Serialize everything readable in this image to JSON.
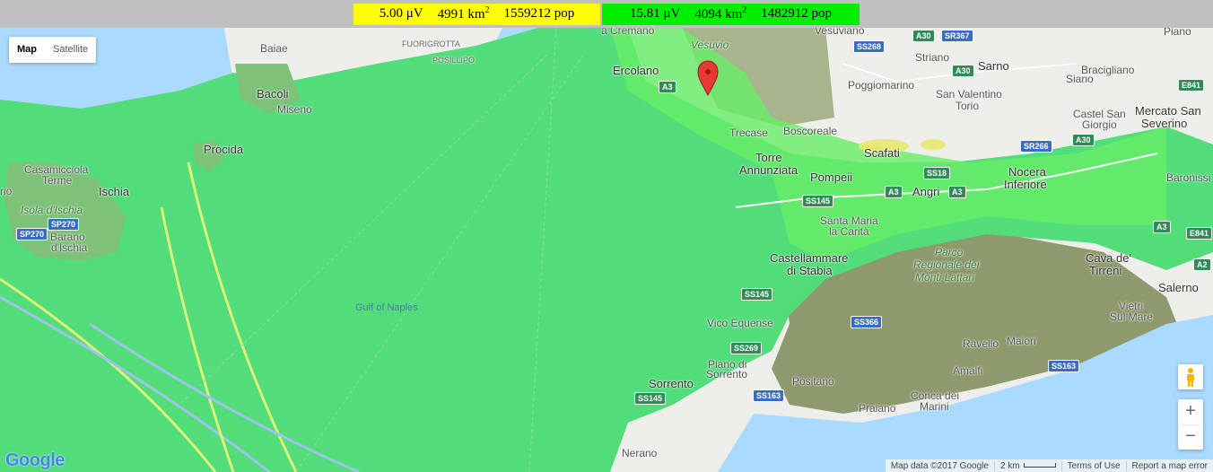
{
  "legend": [
    {
      "level": "5.00 μV",
      "area_base": "4991 km",
      "area_sup": "2",
      "pop": "1559212 pop",
      "color": "#ffff00"
    },
    {
      "level": "15.81 μV",
      "area_base": "4094 km",
      "area_sup": "2",
      "pop": "1482912 pop",
      "color": "#00ee00"
    }
  ],
  "map_type": {
    "map_label": "Map",
    "satellite_label": "Satellite",
    "selected": "Map"
  },
  "places": {
    "baiae": "Baiae",
    "fuorigrotta": "FUORIGROTTA",
    "posillipo": "POSILLIPO",
    "bacoli": "Bacoli",
    "miseno": "Miseno",
    "procida": "Procida",
    "casamicciola": "Casamicciola",
    "terme": "Terme",
    "ischia": "Ischia",
    "isola_ischia": "Isola d'Ischia",
    "barano": "Barano",
    "dischia": "d'Ischia",
    "rio": "rio",
    "cremano": "a Cremano",
    "vesuvio": "Vesuvio",
    "vesuviano": "Vesuviano",
    "ercolano": "Ercolano",
    "striano": "Striano",
    "sarno": "Sarno",
    "bracigliano": "Bracigliano",
    "piano": "Piano",
    "poggiomarino": "Poggiomarino",
    "san_valentino": "San Valentino",
    "torio": "Torio",
    "siano": "Siano",
    "castel_san": "Castel San",
    "giorgio": "Giorgio",
    "mercato": "Mercato San",
    "severino": "Severino",
    "trecase": "Trecase",
    "boscoreale": "Boscoreale",
    "scafati": "Scafati",
    "torre": "Torre",
    "annunziata": "Annunziata",
    "pompeii": "Pompeii",
    "angri": "Angri",
    "nocera": "Nocera",
    "inferiore": "Inferiore",
    "baronissi": "Baronissi",
    "santa_maria": "Santa Maria",
    "la_carita": "la Carità",
    "castellammare": "Castellammare",
    "di_stabia": "di Stabia",
    "parco1": "Parco",
    "parco2": "Regionale dei",
    "parco3": "Monti Lattari",
    "cava": "Cava de'",
    "tirreni": "Tirreni",
    "salerno": "Salerno",
    "vietri": "Vietri",
    "sul_mare": "Sul Mare",
    "vico": "Vico Equense",
    "ravello": "Ravello",
    "maiori": "Maiori",
    "amalfi": "Amalfi",
    "piano_di": "Piano di",
    "sorrento_small": "Sorrento",
    "sorrento": "Sorrento",
    "positano": "Positano",
    "praiano": "Praiano",
    "conca": "Conca dei",
    "marini": "Marini",
    "nerano": "Nerano",
    "gulf": "Gulf of Naples"
  },
  "shields": {
    "a30_1": "A30",
    "sr367": "SR367",
    "ss268": "SS268",
    "a30_2": "A30",
    "e841_1": "E841",
    "a3_1": "A3",
    "sr266": "SR266",
    "a30_3": "A30",
    "ss18": "SS18",
    "ss145_1": "SS145",
    "a3_2": "A3",
    "a3_3": "A3",
    "a3_4": "A3",
    "e841_2": "E841",
    "a2": "A2",
    "ss145_2": "SS145",
    "ss366": "SS366",
    "ss269": "SS269",
    "ss163_1": "SS163",
    "ss145_3": "SS145",
    "ss163_2": "SS163",
    "sp270_1": "SP270",
    "sp270_2": "SP270"
  },
  "attribution": {
    "map_data": "Map data ©2017 Google",
    "scale": "2 km",
    "terms": "Terms of Use",
    "report": "Report a map error"
  },
  "zoom": {
    "in": "+",
    "out": "−"
  },
  "logo": "Google",
  "colors": {
    "coverage": "#52dc7a",
    "coverage_strong": "#66ee66",
    "weak_signal": "#ffff00",
    "water": "#aadaff",
    "land": "#eeeeea",
    "marker": "#e53935"
  }
}
